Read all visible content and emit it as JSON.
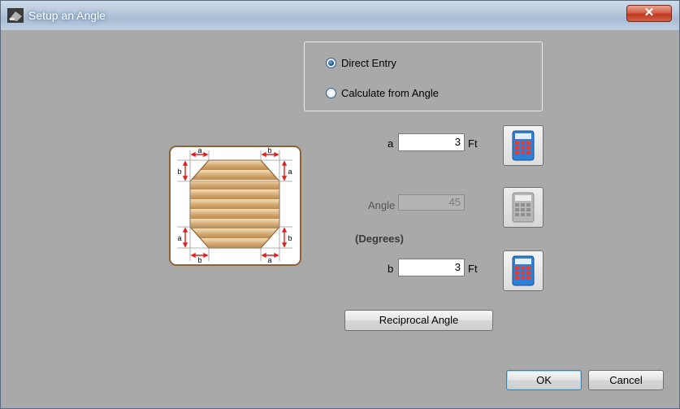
{
  "window": {
    "title": "Setup an Angle",
    "close_glyph": "✕"
  },
  "mode": {
    "options": [
      {
        "label": "Direct Entry",
        "checked": true
      },
      {
        "label": "Calculate from Angle",
        "checked": false
      }
    ]
  },
  "diagram": {
    "label_a": "a",
    "label_b": "b",
    "wood_color": "#d9b583",
    "arrow_color": "#e02020"
  },
  "fields": {
    "a": {
      "label": "a",
      "value": "3",
      "unit": "Ft"
    },
    "angle": {
      "label": "Angle",
      "value": "45",
      "unit_label": "(Degrees)"
    },
    "b": {
      "label": "b",
      "value": "3",
      "unit": "Ft"
    }
  },
  "buttons": {
    "reciprocal": "Reciprocal Angle",
    "ok": "OK",
    "cancel": "Cancel"
  },
  "icons": {
    "calculator": "calculator-icon",
    "app": "app-icon"
  }
}
